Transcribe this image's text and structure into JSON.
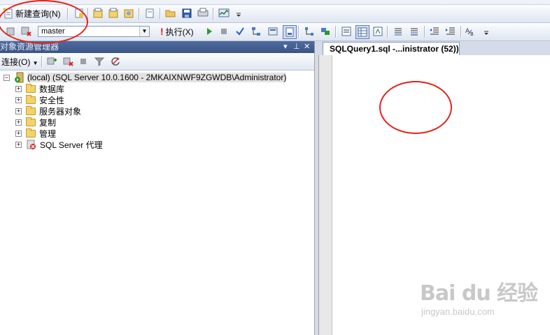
{
  "colors": {
    "annotation": "#e3231a",
    "panel_title_bg": "#3b5584"
  },
  "toolbar1": {
    "new_query_label": "新建查询(N)"
  },
  "toolbar2": {
    "database_value": "master",
    "execute_label": "执行(X)"
  },
  "object_explorer": {
    "title": "对象资源管理器",
    "connect_label": "连接(O)",
    "server_node": "(local) (SQL Server 10.0.1600 - 2MKAIXNWF9ZGWDB\\Administrator)",
    "children": [
      {
        "label": "数据库",
        "icon": "folder-icon"
      },
      {
        "label": "安全性",
        "icon": "folder-icon"
      },
      {
        "label": "服务器对象",
        "icon": "folder-icon"
      },
      {
        "label": "复制",
        "icon": "folder-icon"
      },
      {
        "label": "管理",
        "icon": "folder-icon"
      },
      {
        "label": "SQL Server 代理",
        "icon": "sql-agent-icon"
      }
    ],
    "pin_label": "ᵩ",
    "close_label": "✕"
  },
  "editor": {
    "tab_title": "SQLQuery1.sql -...inistrator (52))"
  },
  "watermark": {
    "main": "Bai du 经验",
    "sub": "jingyan.baidu.com"
  }
}
